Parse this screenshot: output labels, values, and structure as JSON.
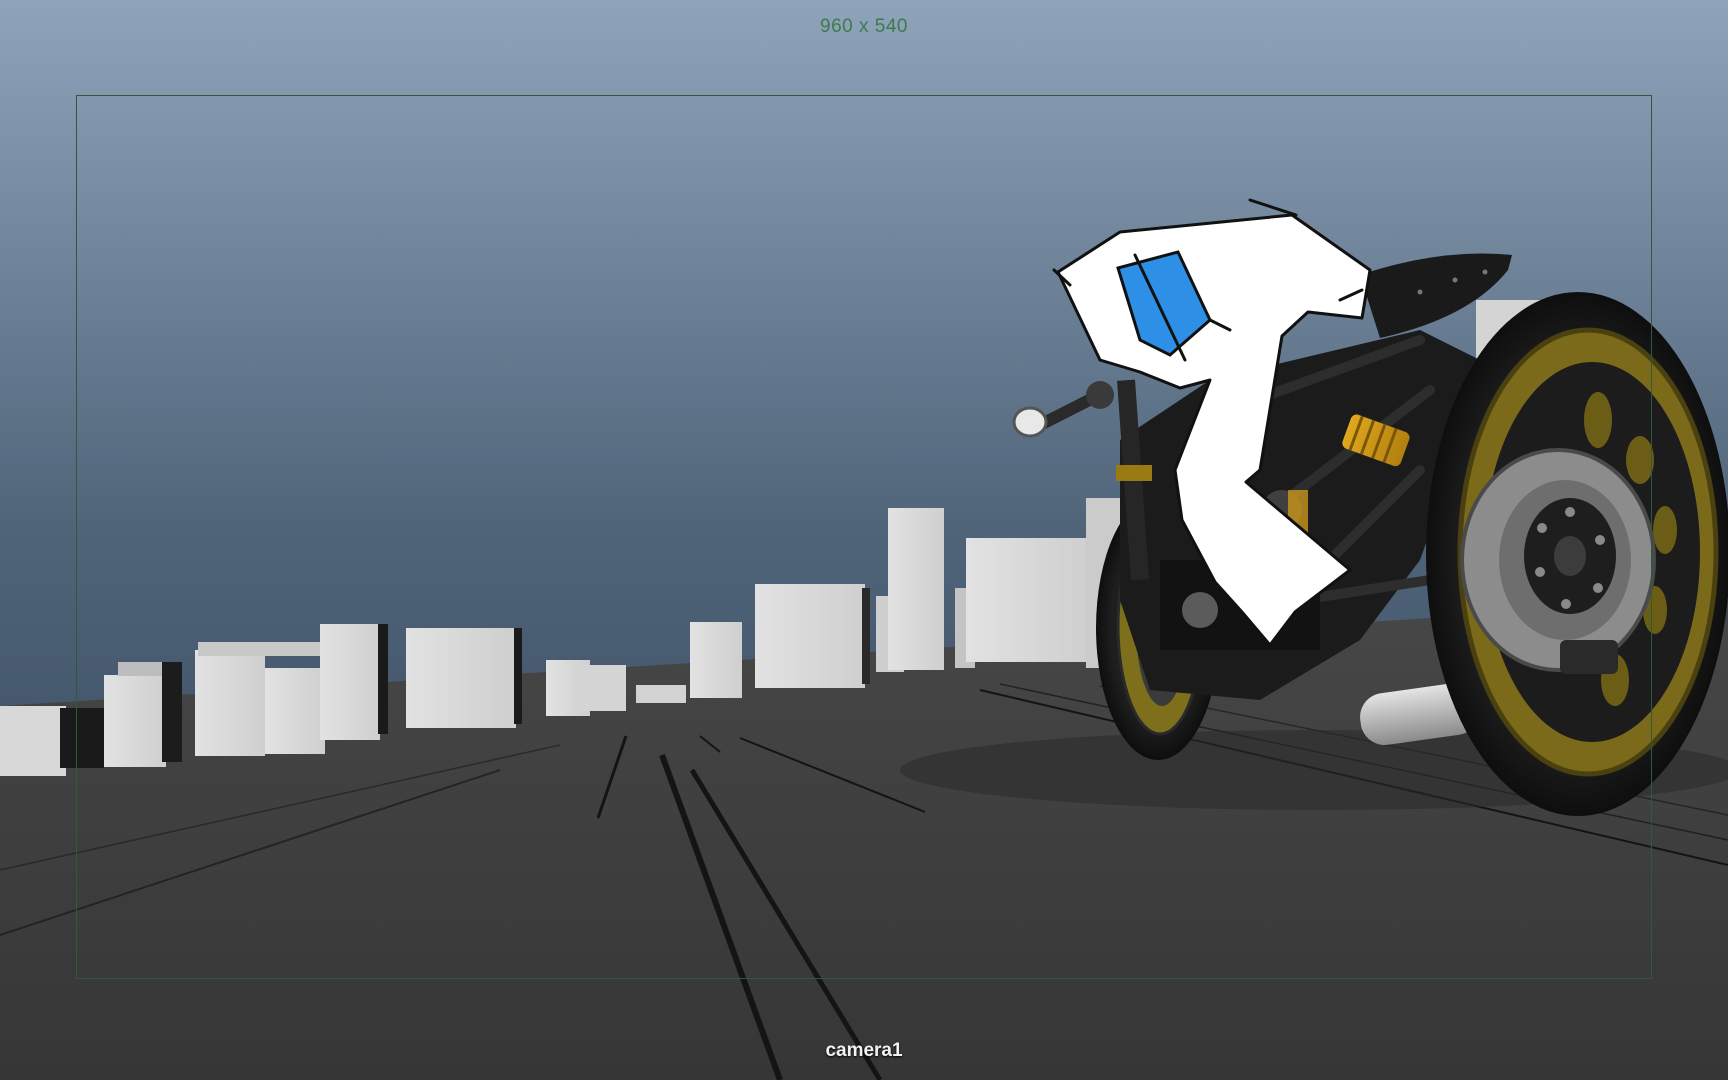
{
  "viewport": {
    "resolution_label": "960 x 540",
    "camera_label": "camera1"
  },
  "colors": {
    "sky_top": "#8fa3ba",
    "sky_bottom": "#4a5e74",
    "ground": "#3d3d3d",
    "building": "#d9d9d9",
    "gate": "#2f5a3a",
    "rider_body": "#ffffff",
    "rider_visor": "#2e8fe6",
    "wheel_rim": "#8a7a1e"
  },
  "scene_objects": [
    "background-buildings",
    "road-lines",
    "motorcycle",
    "rider-sketch"
  ]
}
